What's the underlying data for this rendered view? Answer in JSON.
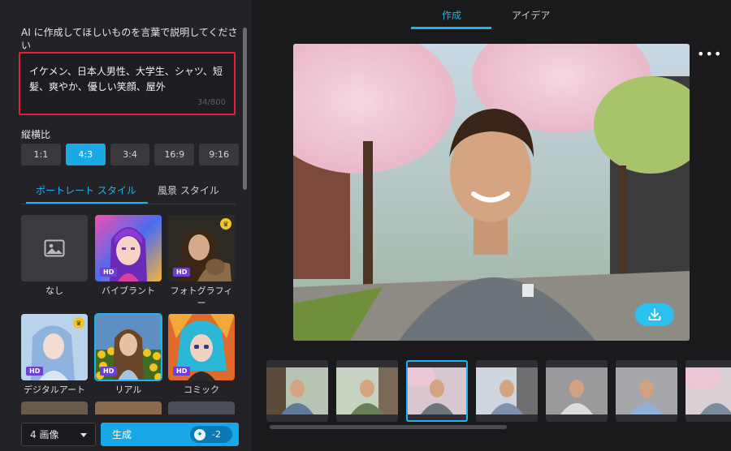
{
  "prompt": {
    "title": "AI に作成してほしいものを言葉で説明してください",
    "value": "イケメン、日本人男性、大学生、シャツ、短髪、爽やか、優しい笑顔、屋外",
    "counter": "34/800"
  },
  "aspect": {
    "label": "縦横比",
    "options": [
      "1:1",
      "4:3",
      "3:4",
      "16:9",
      "9:16"
    ],
    "selected": "4:3"
  },
  "style_tabs": [
    "ポートレート スタイル",
    "風景 スタイル"
  ],
  "styles": [
    {
      "label": "なし",
      "hd": "",
      "premium": false,
      "selected": false
    },
    {
      "label": "バイブラント",
      "hd": "HD",
      "premium": false,
      "selected": false
    },
    {
      "label": "フォトグラフィー",
      "hd": "HD",
      "premium": true,
      "selected": false
    },
    {
      "label": "デジタルアート",
      "hd": "HD",
      "premium": true,
      "selected": false
    },
    {
      "label": "リアル",
      "hd": "HD",
      "premium": false,
      "selected": true
    },
    {
      "label": "コミック",
      "hd": "HD",
      "premium": false,
      "selected": false
    }
  ],
  "footer": {
    "count": "4 画像",
    "generate": "生成",
    "credits": "-2"
  },
  "right_tabs": [
    "作成",
    "アイデア"
  ],
  "icons": {
    "placeholder": "image-placeholder-icon",
    "more": "more-icon",
    "download": "download-icon",
    "crown": "crown-icon",
    "credit": "credit-icon",
    "dropdown": "chevron-down-icon"
  },
  "colors": {
    "accent": "#1fb3f0",
    "highlight_border": "#e2203a",
    "hd_badge": "#6e3fd6",
    "crown": "#f3c423"
  }
}
